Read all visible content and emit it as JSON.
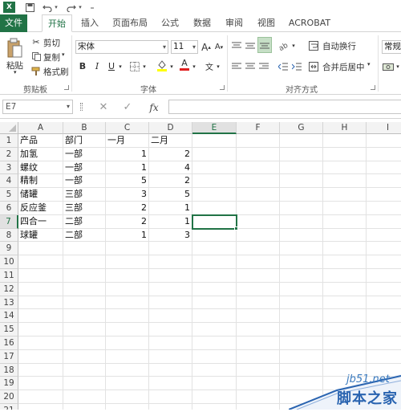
{
  "quick_access": {
    "dropdown": "₌"
  },
  "tabs": [
    "文件",
    "开始",
    "插入",
    "页面布局",
    "公式",
    "数据",
    "审阅",
    "视图",
    "ACROBAT"
  ],
  "ribbon": {
    "clipboard": {
      "paste": "粘贴",
      "cut": "剪切",
      "copy": "复制",
      "format_painter": "格式刷",
      "label": "剪贴板"
    },
    "font": {
      "name": "宋体",
      "size": "11",
      "grow": "A",
      "shrink": "A",
      "bold": "B",
      "italic": "I",
      "underline": "U",
      "font_color": "A",
      "phonetic": "文",
      "label": "字体"
    },
    "alignment": {
      "wrap_text": "自动换行",
      "merge_center": "合并后居中",
      "label": "对齐方式"
    },
    "number": {
      "format": "常规"
    }
  },
  "formula_bar": {
    "name_box": "E7",
    "fx": "fx",
    "cancel": "✕",
    "enter": "✓",
    "value": ""
  },
  "sheet": {
    "columns": [
      "A",
      "B",
      "C",
      "D",
      "E",
      "F",
      "G",
      "H",
      "I"
    ],
    "rows": [
      "1",
      "2",
      "3",
      "4",
      "5",
      "6",
      "7",
      "8",
      "9",
      "10",
      "11",
      "12",
      "13",
      "14",
      "15",
      "16",
      "17",
      "18",
      "19",
      "20",
      "21"
    ],
    "selected_cell": "E7",
    "cells": [
      [
        "产品",
        "部门",
        "一月",
        "二月"
      ],
      [
        "加氢",
        "一部",
        1,
        2
      ],
      [
        "螺纹",
        "一部",
        1,
        4
      ],
      [
        "精制",
        "一部",
        5,
        2
      ],
      [
        "储罐",
        "三部",
        3,
        5
      ],
      [
        "反应釜",
        "三部",
        2,
        1
      ],
      [
        "四合一",
        "二部",
        2,
        1
      ],
      [
        "球罐",
        "二部",
        1,
        3
      ]
    ]
  },
  "watermark": {
    "site": "jb51.net",
    "brand": "脚本之家"
  }
}
